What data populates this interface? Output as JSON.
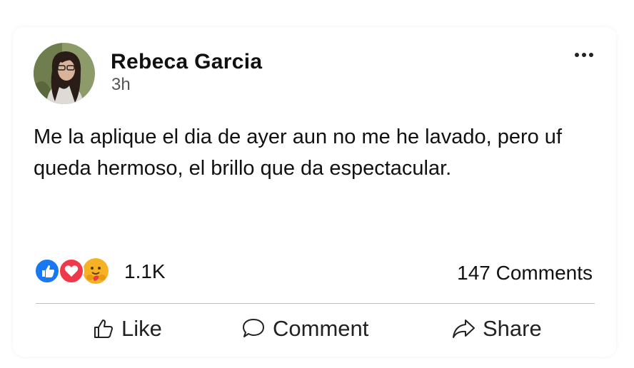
{
  "post": {
    "author": "Rebeca Garcia",
    "time": "3h",
    "text": "Me la aplique el dia de ayer aun no me he lavado, pero uf queda hermoso, el brillo que da espectacular.",
    "avatar": "profile-photo",
    "more_icon": "more-horizontal-icon"
  },
  "stats": {
    "reactions_count": "1.1K",
    "reaction_icons": [
      "like-reaction-icon",
      "love-reaction-icon",
      "care-reaction-icon"
    ],
    "comments_count": "147 Comments"
  },
  "actions": {
    "like": "Like",
    "comment": "Comment",
    "share": "Share"
  },
  "colors": {
    "like_blue": "#1877f2",
    "love_red": "#f0384b",
    "care_yellow": "#f7b125",
    "divider": "#b9c1cf"
  }
}
